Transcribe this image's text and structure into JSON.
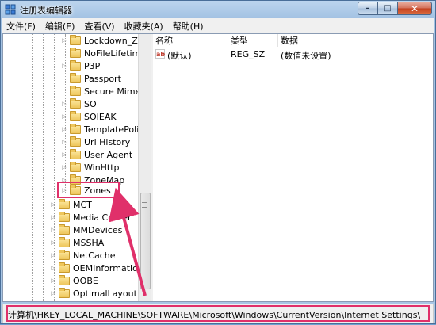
{
  "window": {
    "title": "注册表编辑器",
    "minimize_glyph": "–",
    "maximize_glyph": "□",
    "close_glyph": "✕"
  },
  "menu": [
    "文件(F)",
    "编辑(E)",
    "查看(V)",
    "收藏夹(A)",
    "帮助(H)"
  ],
  "tree": {
    "inner_items": [
      "Lockdown_Zo",
      "NoFileLifetim",
      "P3P",
      "Passport",
      "Secure Mime",
      "SO",
      "SOIEAK",
      "TemplatePolic",
      "Url History",
      "User Agent",
      "WinHttp",
      "ZoneMap",
      "Zones"
    ],
    "selected": "Zones",
    "outer_items": [
      "MCT",
      "Media Center",
      "MMDevices",
      "MSSHA",
      "NetCache",
      "OEMInformation",
      "OOBE",
      "OptimalLayout"
    ]
  },
  "list": {
    "columns": [
      "名称",
      "类型",
      "数据"
    ],
    "rows": [
      {
        "name": "(默认)",
        "type": "REG_SZ",
        "data": "(数值未设置)",
        "icon": "ab-string-icon"
      }
    ]
  },
  "status": {
    "path": "计算机\\HKEY_LOCAL_MACHINE\\SOFTWARE\\Microsoft\\Windows\\CurrentVersion\\Internet Settings\\Zones"
  },
  "colors": {
    "annotation": "#e0306a"
  }
}
